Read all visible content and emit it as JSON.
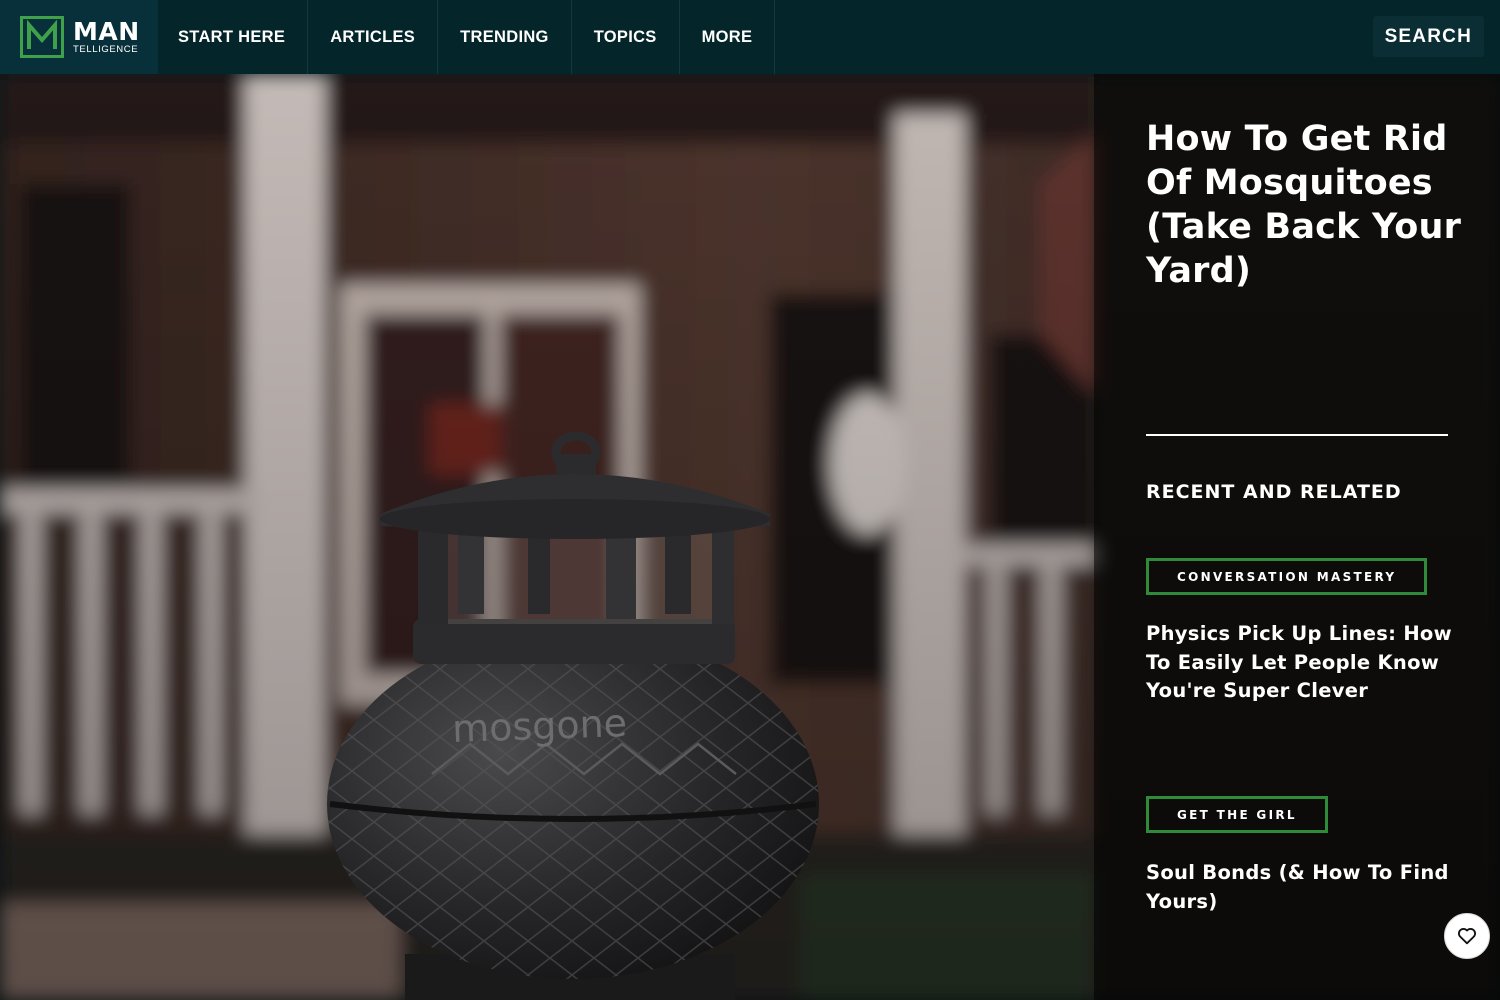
{
  "brand": {
    "logo_letter": "M",
    "name": "MAN",
    "sub": "TELLIGENCE"
  },
  "nav": {
    "items": [
      {
        "label": "START HERE"
      },
      {
        "label": "ARTICLES"
      },
      {
        "label": "TRENDING"
      },
      {
        "label": "TOPICS"
      },
      {
        "label": "MORE"
      }
    ],
    "search_label": "SEARCH"
  },
  "hero": {
    "image_brand_text": "mosgone",
    "post_title": "How To Get Rid Of Mosquitoes (Take Back Your Yard)"
  },
  "related": {
    "heading": "RECENT AND RELATED",
    "items": [
      {
        "tag": "CONVERSATION MASTERY",
        "title": "Physics Pick Up Lines: How To Easily Let People Know You're Super Clever"
      },
      {
        "tag": "GET THE GIRL",
        "title": "Soul Bonds (& How To Find Yours)"
      }
    ]
  },
  "icons": {
    "favorite": "heart-icon"
  },
  "colors": {
    "nav_bg": "#04252a",
    "accent_green": "#2f8a3a",
    "logo_green": "#3fa14a"
  }
}
